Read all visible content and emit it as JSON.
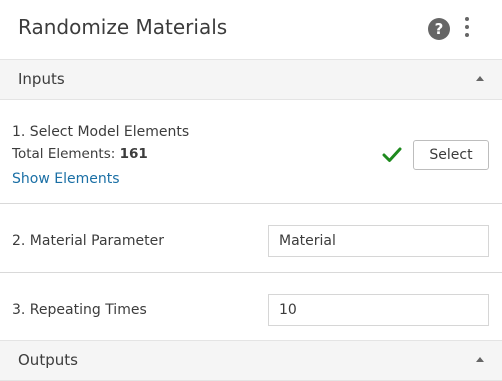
{
  "header": {
    "title": "Randomize Materials",
    "help_icon_glyph": "?",
    "help_icon_name": "help-icon",
    "menu_icon_name": "more-vertical-icon"
  },
  "sections": {
    "inputs_label": "Inputs",
    "outputs_label": "Outputs"
  },
  "inputs": {
    "select_elements": {
      "label": "1. Select Model Elements",
      "total_label": "Total Elements:",
      "total_value": "161",
      "show_link": "Show Elements",
      "status_icon": "check-icon",
      "status_color": "#1e8a1e",
      "button_label": "Select"
    },
    "material_parameter": {
      "label": "2. Material Parameter",
      "value": "Material"
    },
    "repeating_times": {
      "label": "3. Repeating Times",
      "value": "10"
    }
  },
  "colors": {
    "link": "#1a6fa5",
    "section_bg": "#f5f5f5",
    "text": "#3c3c3c"
  }
}
